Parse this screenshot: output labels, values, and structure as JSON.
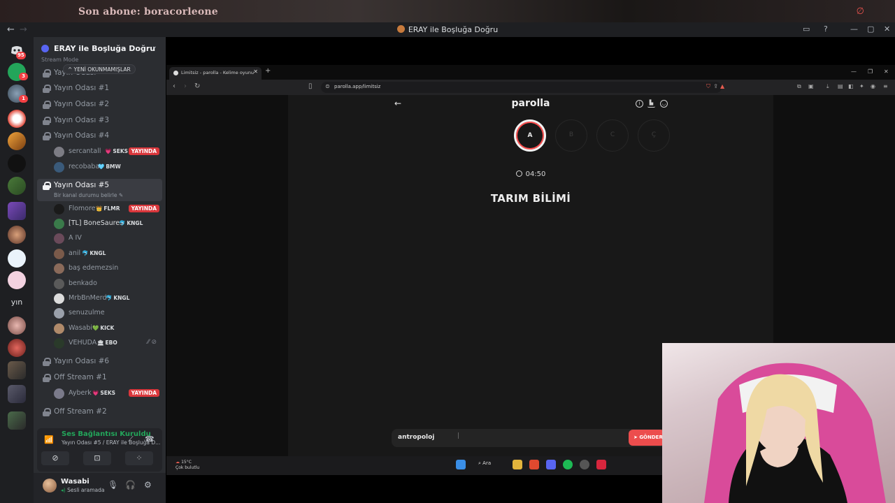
{
  "overlay": {
    "subscriber_text": "Son abone: boracorleone"
  },
  "window": {
    "title": "ERAY ile Boşluğa Doğru"
  },
  "rail": {
    "badges": [
      "95",
      "3",
      "1"
    ],
    "text_item": "yın"
  },
  "guild": {
    "name": "ERAY ile Boşluğa Doğru",
    "stream_mode": "Stream Mode",
    "unread_pill": "YENİ OKUNMAMIŞLAR"
  },
  "channels": {
    "c0": "Yayın Odası",
    "c1": "Yayın Odası #1",
    "c2": "Yayın Odası #2",
    "c3": "Yayın Odası #3",
    "c4": "Yayın Odası #4",
    "c5": "Yayın Odası #5",
    "c5_sub": "Bir kanal durumu belirle",
    "c6": "Yayın Odası #6",
    "os1": "Off Stream #1",
    "os2": "Off Stream #2"
  },
  "live_label": "YAYINDA",
  "users": {
    "u1": {
      "name": "sercantall",
      "tag": "SEKS",
      "tag_icon": "💗"
    },
    "u2": {
      "name": "recobaba",
      "tag": "BMW",
      "tag_icon": "🩵"
    },
    "u3": {
      "name": "Flomore",
      "tag": "FLMR",
      "tag_icon": "👑"
    },
    "u4": {
      "name": "[TL] BoneSaures",
      "tag": "KNGL",
      "tag_icon": "🐬"
    },
    "u5": {
      "name": "A IV"
    },
    "u6": {
      "name": "anil",
      "tag": "KNGL",
      "tag_icon": "🐬"
    },
    "u7": {
      "name": "baş edemezsin"
    },
    "u8": {
      "name": "benkado"
    },
    "u9": {
      "name": "MrbBnMerd",
      "tag": "KNGL",
      "tag_icon": "🐬"
    },
    "u10": {
      "name": "senuzulme"
    },
    "u11": {
      "name": "Wasabi",
      "tag": "KICK",
      "tag_icon": "💚"
    },
    "u12": {
      "name": "VEHUDA",
      "tag": "EBO",
      "tag_icon": "🏛"
    },
    "u13": {
      "name": "Ayberk",
      "tag": "SEKS",
      "tag_icon": "💗"
    }
  },
  "voice": {
    "status": "Ses Bağlantısı Kuruldu",
    "location": "Yayın Odası #5 / ERAY ile Boşluğa D..."
  },
  "me": {
    "name": "Wasabi",
    "status": "Sesli aramada"
  },
  "browser": {
    "tab_title": "Limitsiz - parolla - Kelime oyunu",
    "url": "parolla.app/limitsiz"
  },
  "game": {
    "brand": "parolla",
    "letters": [
      "A",
      "B",
      "C",
      "Ç"
    ],
    "timer": "04:50",
    "category": "TARIM BİLİMİ",
    "answer": "antropoloj",
    "send_label": "GÖNDER"
  },
  "taskbar": {
    "temp": "15°C",
    "weather": "Çok bulutlu",
    "search": "Ara"
  },
  "colors": {
    "accent_live": "#da373c",
    "voice_green": "#23a55a",
    "send_button": "#ec4d4d",
    "brand": "#5865f2"
  }
}
